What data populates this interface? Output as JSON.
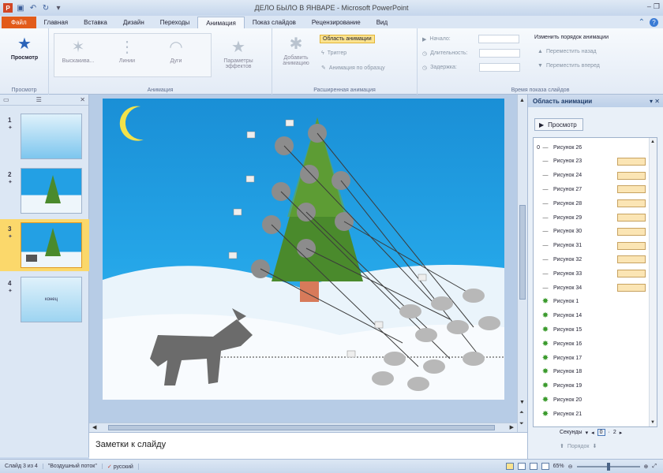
{
  "window": {
    "title": "ДЕЛО БЫЛО В ЯНВАРЕ - Microsoft PowerPoint"
  },
  "tabs": [
    {
      "label": "Файл",
      "active": false
    },
    {
      "label": "Главная",
      "active": false
    },
    {
      "label": "Вставка",
      "active": false
    },
    {
      "label": "Дизайн",
      "active": false
    },
    {
      "label": "Переходы",
      "active": false
    },
    {
      "label": "Анимация",
      "active": true
    },
    {
      "label": "Показ слайдов",
      "active": false
    },
    {
      "label": "Рецензирование",
      "active": false
    },
    {
      "label": "Вид",
      "active": false
    }
  ],
  "ribbon": {
    "preview": {
      "button": "Просмотр",
      "group": "Просмотр"
    },
    "animation": {
      "group": "Анимация",
      "items": [
        "Выскакива...",
        "Линии",
        "Дуги"
      ],
      "effect_params": "Параметры эффектов"
    },
    "advanced": {
      "group": "Расширенная анимация",
      "add_animation": "Добавить анимацию",
      "animation_pane": "Область анимации",
      "trigger": "Триггер",
      "painter": "Анимация по образцу"
    },
    "timing": {
      "group": "Время показа слайдов",
      "start": "Начало:",
      "duration": "Длительность:",
      "delay": "Задержка:",
      "reorder": "Изменить порядок анимации",
      "move_back": "Переместить назад",
      "move_forward": "Переместить вперед"
    }
  },
  "thumbnails": [
    {
      "num": "1",
      "label": ""
    },
    {
      "num": "2",
      "label": ""
    },
    {
      "num": "3",
      "label": ""
    },
    {
      "num": "4",
      "label": "конец"
    }
  ],
  "notes_placeholder": "Заметки к слайду",
  "anim_pane": {
    "title": "Область анимации",
    "preview_button": "Просмотр",
    "items": [
      {
        "num": "0",
        "name": "Рисунок 26",
        "kind": "line",
        "bar": false
      },
      {
        "num": "",
        "name": "Рисунок 23",
        "kind": "line",
        "bar": true
      },
      {
        "num": "",
        "name": "Рисунок 24",
        "kind": "line",
        "bar": true
      },
      {
        "num": "",
        "name": "Рисунок 27",
        "kind": "line",
        "bar": true
      },
      {
        "num": "",
        "name": "Рисунок 28",
        "kind": "line",
        "bar": true
      },
      {
        "num": "",
        "name": "Рисунок 29",
        "kind": "line",
        "bar": true
      },
      {
        "num": "",
        "name": "Рисунок 30",
        "kind": "line",
        "bar": true
      },
      {
        "num": "",
        "name": "Рисунок 31",
        "kind": "line",
        "bar": true
      },
      {
        "num": "",
        "name": "Рисунок 32",
        "kind": "line",
        "bar": true
      },
      {
        "num": "",
        "name": "Рисунок 33",
        "kind": "line",
        "bar": true
      },
      {
        "num": "",
        "name": "Рисунок 34",
        "kind": "line",
        "bar": true
      },
      {
        "num": "",
        "name": "Рисунок 1",
        "kind": "star",
        "bar": false
      },
      {
        "num": "",
        "name": "Рисунок 14",
        "kind": "star",
        "bar": false
      },
      {
        "num": "",
        "name": "Рисунок 15",
        "kind": "star",
        "bar": false
      },
      {
        "num": "",
        "name": "Рисунок 16",
        "kind": "star",
        "bar": false
      },
      {
        "num": "",
        "name": "Рисунок 17",
        "kind": "star",
        "bar": false
      },
      {
        "num": "",
        "name": "Рисунок 18",
        "kind": "star",
        "bar": false
      },
      {
        "num": "",
        "name": "Рисунок 19",
        "kind": "star",
        "bar": false
      },
      {
        "num": "",
        "name": "Рисунок 20",
        "kind": "star",
        "bar": false
      },
      {
        "num": "",
        "name": "Рисунок 21",
        "kind": "star",
        "bar": false
      }
    ],
    "seconds_label": "Секунды",
    "seconds_value": "0",
    "seconds_next": "2",
    "order_label": "Порядок"
  },
  "statusbar": {
    "slide": "Слайд 3 из 4",
    "theme": "\"Воздушный поток\"",
    "lang": "русский",
    "zoom": "65%"
  },
  "colors": {
    "accent": "#e25b1a",
    "sky": "#25a6e8",
    "tree": "#4a8a2c",
    "highlight": "#fbe38f"
  }
}
